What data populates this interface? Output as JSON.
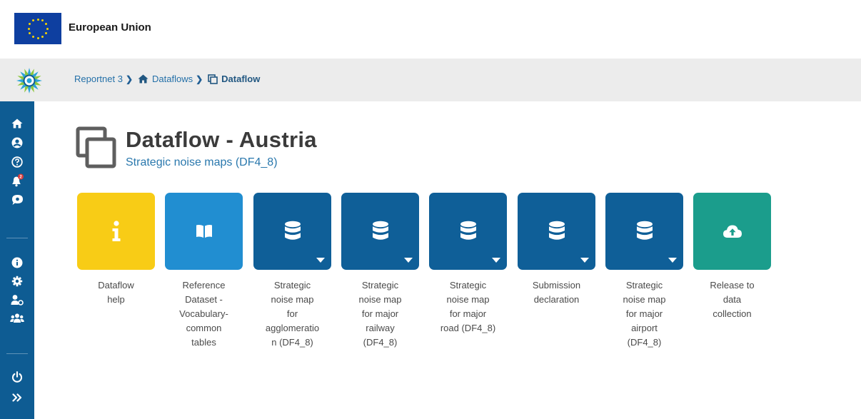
{
  "eu": {
    "title": "European Union"
  },
  "breadcrumb": {
    "items": [
      {
        "label": "Reportnet 3"
      },
      {
        "label": "Dataflows"
      },
      {
        "label": "Dataflow"
      }
    ]
  },
  "page": {
    "title": "Dataflow - Austria",
    "subtitle": "Strategic noise maps (DF4_8)"
  },
  "sidebar": {
    "notifications_badge": "2",
    "icons": [
      "home-icon",
      "user-icon",
      "help-icon",
      "notifications-icon",
      "chat-icon",
      "info-icon",
      "settings-icon",
      "user-settings-icon",
      "team-icon",
      "power-icon",
      "expand-icon"
    ]
  },
  "tiles": [
    {
      "label": "Dataflow\nhelp",
      "icon": "info-icon",
      "color": "#f8cc16",
      "has_menu": false
    },
    {
      "label": "Reference\nDataset -\nVocabulary-\ncommon\ntables",
      "icon": "book-icon",
      "color": "#218ed1",
      "has_menu": false
    },
    {
      "label": "Strategic\nnoise map\nfor\nagglomeratio\nn (DF4_8)",
      "icon": "database-icon",
      "color": "#0f5f98",
      "has_menu": true
    },
    {
      "label": "Strategic\nnoise map\nfor major\nrailway\n(DF4_8)",
      "icon": "database-icon",
      "color": "#0f5f98",
      "has_menu": true
    },
    {
      "label": "Strategic\nnoise map\nfor major\nroad (DF4_8)",
      "icon": "database-icon",
      "color": "#0f5f98",
      "has_menu": true
    },
    {
      "label": "Submission\ndeclaration",
      "icon": "database-icon",
      "color": "#0f5f98",
      "has_menu": true
    },
    {
      "label": "Strategic\nnoise map\nfor major\nairport\n(DF4_8)",
      "icon": "database-icon",
      "color": "#0f5f98",
      "has_menu": true
    },
    {
      "label": "Release to\ndata\ncollection",
      "icon": "cloud-upload-icon",
      "color": "#1b9d8c",
      "has_menu": false
    }
  ]
}
